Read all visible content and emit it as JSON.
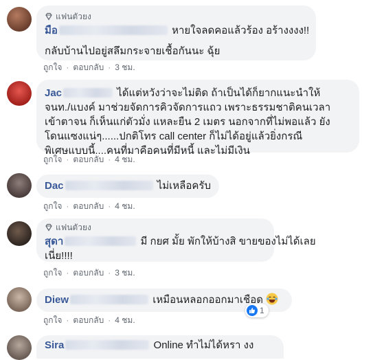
{
  "comments": [
    {
      "fan_badge": "แฟนตัวยง",
      "author_visible": "มือ",
      "lines": [
        "หายใจลดคอแล้วร้อง อร้างงงง!!",
        "กลับบ้านไปอยู่สลึมกระจายเชื้อกันนะ ฉุ้ย"
      ],
      "like_label": "ถูกใจ",
      "reply_label": "ตอบกลับ",
      "time": "3 ชม."
    },
    {
      "author_visible": "Jac",
      "lines": [
        "ได้แต่หวังว่าจะไม่ติด ถ้าเป็นได้ก็ยากแนะนำให้",
        "จนท./แบงค์ มาช่วยจัดการคิวจัดการแถว เพราะธรรมชาติคนเวลา",
        "เข้าตาจน ก็เห็นแก่ตัวมั่ง แหละยืน 2 เมตร นอกจากที่ไม่พอแล้ว ยัง",
        "โดนแซงแน่ๆ......ปกติโทร call center ก็ไม่ได้อยู่แล้วยิ่งกรณี",
        "พิเศษแบบนี้....คนที่มาคือคนที่มีหนี้ และไม่มีเงิน"
      ],
      "like_label": "ถูกใจ",
      "reply_label": "ตอบกลับ",
      "time": "4 ชม."
    },
    {
      "author_visible": "Dac",
      "lines": [
        "ไม่เหลือครับ"
      ],
      "like_label": "ถูกใจ",
      "reply_label": "ตอบกลับ",
      "time": "4 ชม."
    },
    {
      "fan_badge": "แฟนตัวยง",
      "author_visible": "สุดา",
      "lines": [
        "มี กยศ มั้ย พักให้บ้างสิ ขายของไม่ได้เลย",
        "เนี่ย!!!!"
      ],
      "like_label": "ถูกใจ",
      "reply_label": "ตอบกลับ",
      "time": "3 ชม."
    },
    {
      "author_visible": "Diew",
      "lines": [
        "เหมือนหลอกออกมาเชือด"
      ],
      "emoji": "laughing-crying-emoji",
      "reaction_count": "1",
      "like_label": "ถูกใจ",
      "reply_label": "ตอบกลับ",
      "time": "4 ชม."
    },
    {
      "author_visible": "Sira",
      "lines": [
        "Online ทำไม่ได้หรา งง"
      ]
    }
  ],
  "icons": {
    "fan_badge": "diamond-icon",
    "reaction": "like-thumb-icon"
  },
  "colors": {
    "author": "#385898",
    "bubble": "#f2f3f5",
    "meta": "#606770",
    "like": "#1877f2"
  }
}
